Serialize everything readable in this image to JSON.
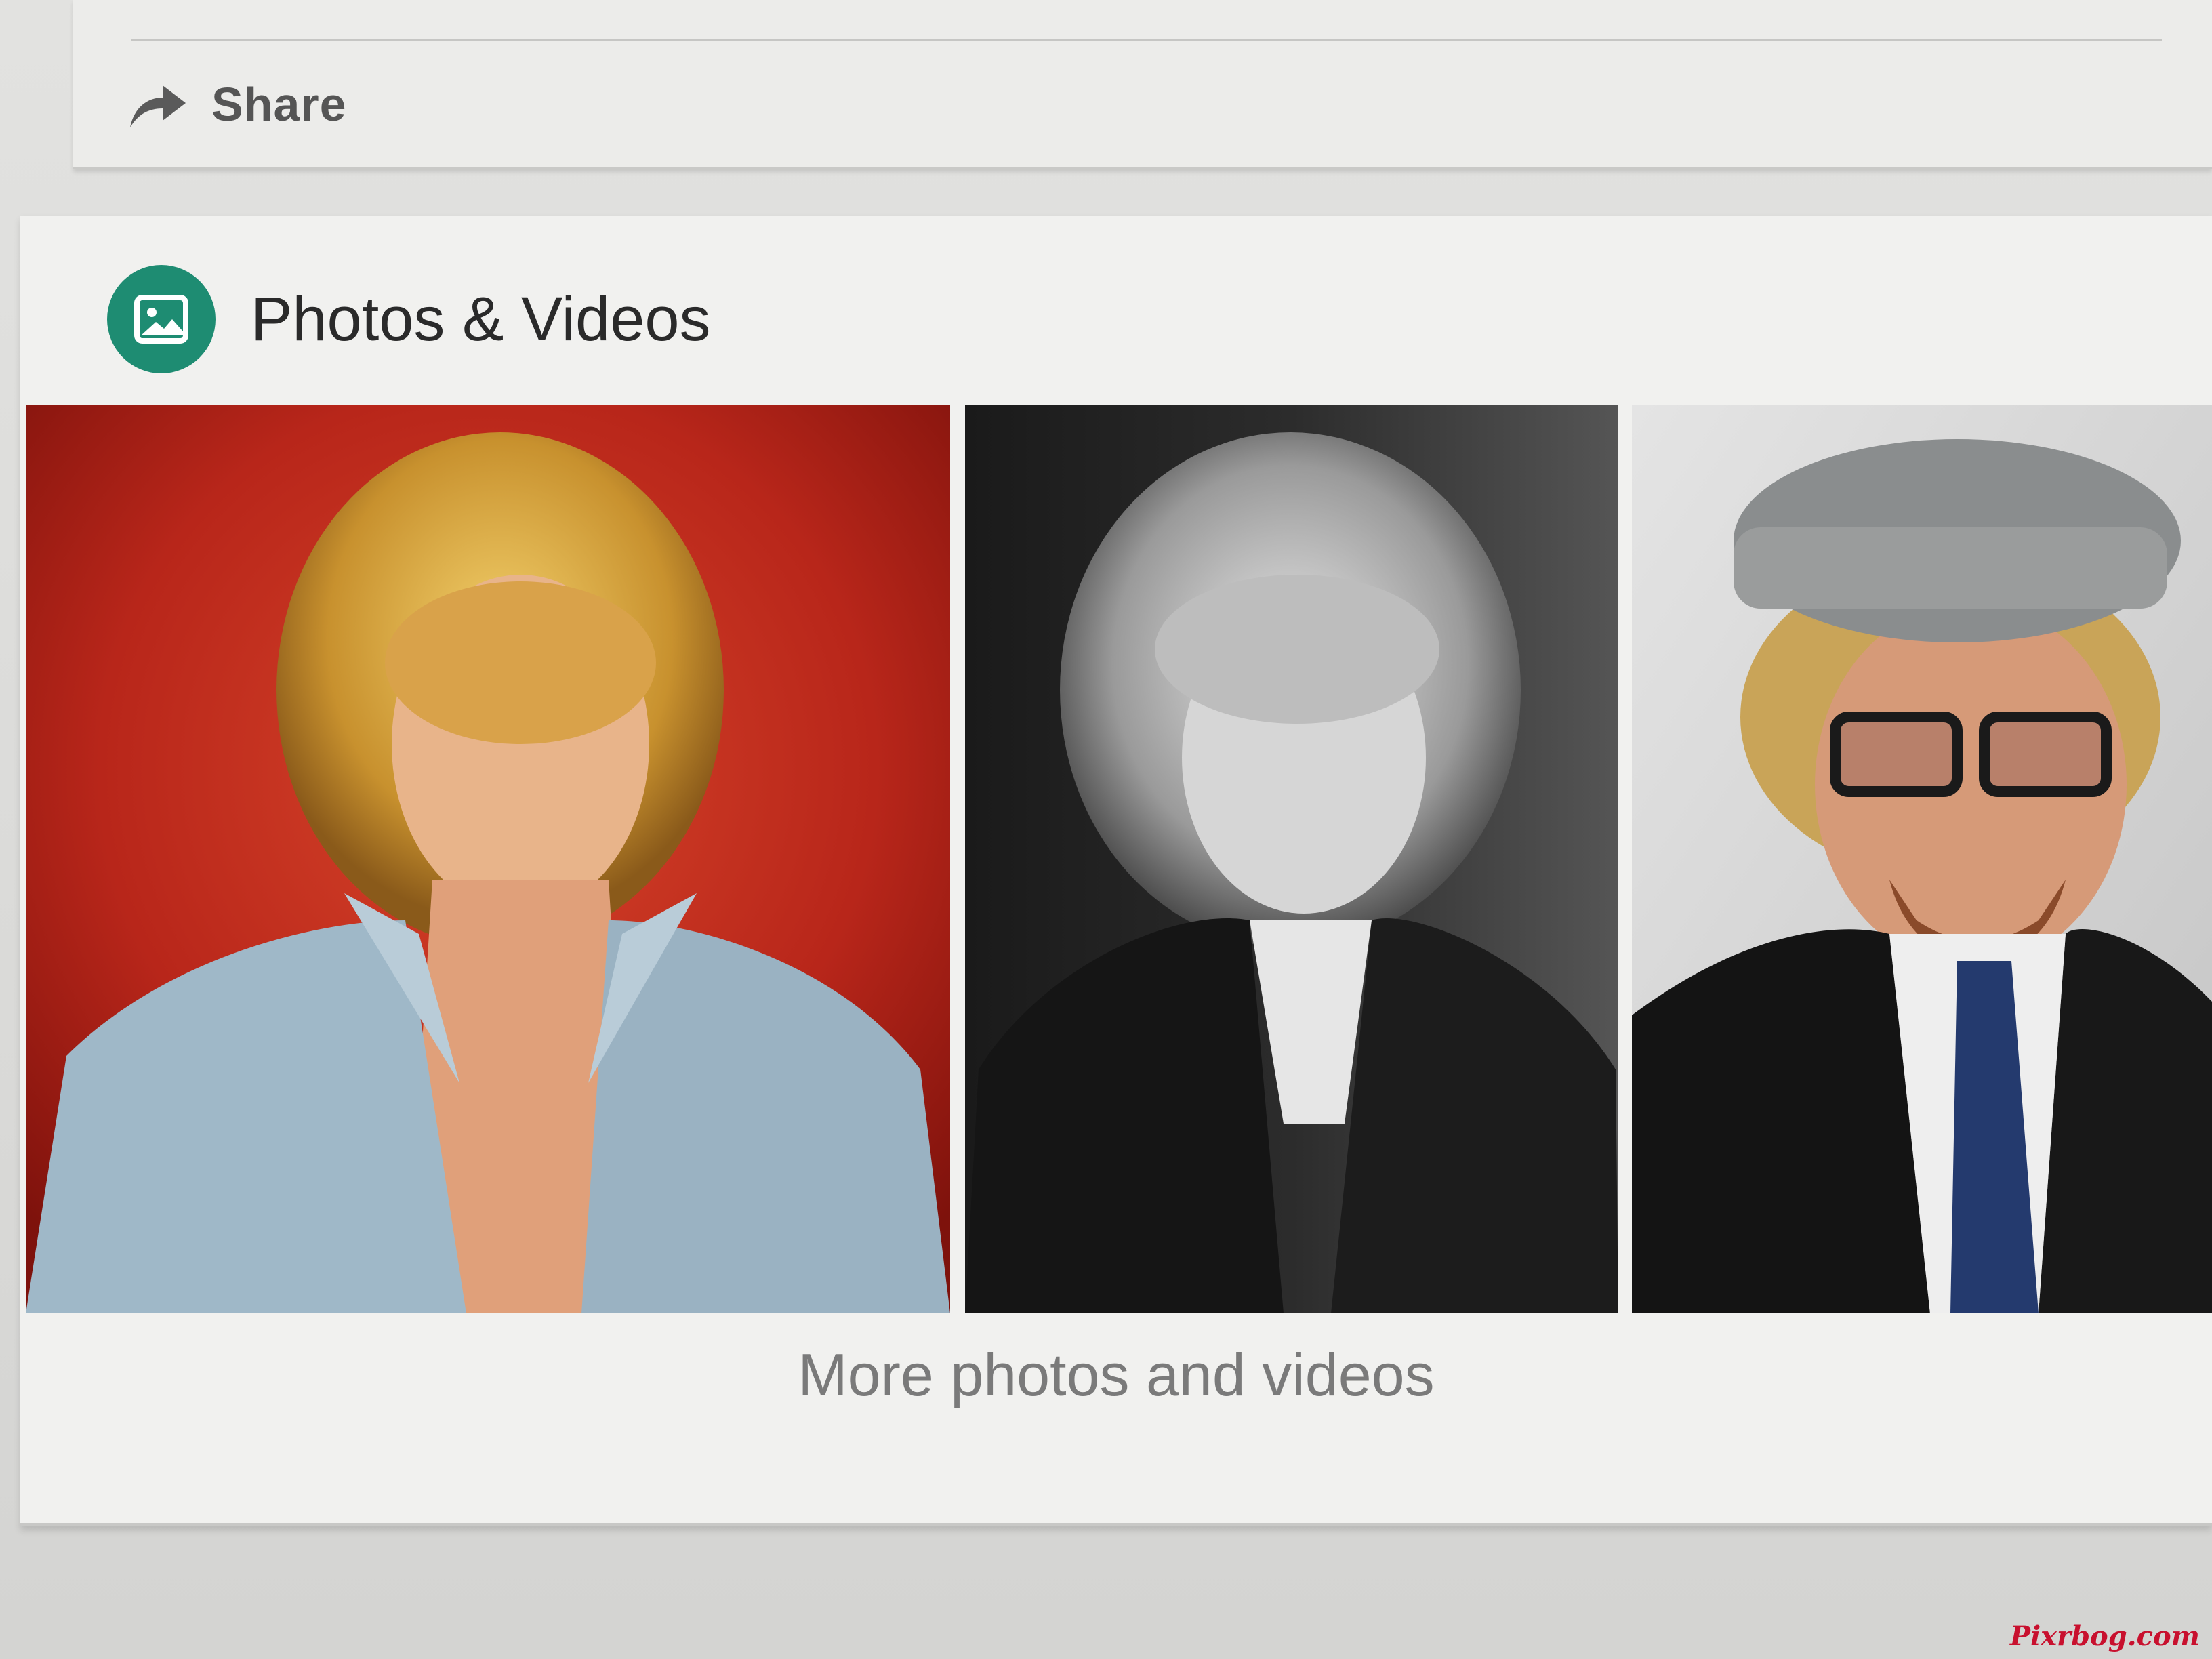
{
  "share": {
    "label": "Share",
    "icon": "share-arrow-icon"
  },
  "photos_section": {
    "title": "Photos & Videos",
    "icon": "image-icon",
    "accent_color": "#1e8c72",
    "photos": [
      {
        "icon": "photo-thumbnail",
        "style": "color portrait, red background"
      },
      {
        "icon": "photo-thumbnail",
        "style": "black and white portrait"
      },
      {
        "icon": "photo-thumbnail",
        "style": "color portrait, grey backdrop"
      }
    ],
    "more_label": "More photos and videos"
  },
  "watermark": "Pixrbog.com"
}
